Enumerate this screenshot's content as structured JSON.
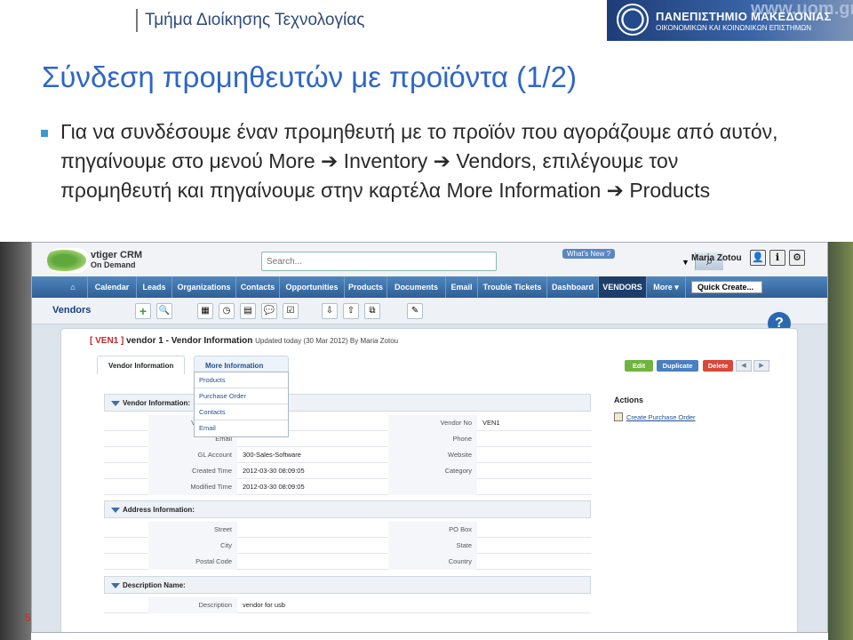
{
  "slide": {
    "department": "Τμήμα Διοίκησης Τεχνολογίας",
    "university_line1": "ΠΑΝΕΠΙΣΤΗΜΙΟ ΜΑΚΕΔΟΝΙΑΣ",
    "university_line2": "ΟΙΚΟΝΟΜΙΚΩΝ ΚΑΙ ΚΟΙΝΩΝΙΚΩΝ ΕΠΙΣΤΗΜΩΝ",
    "university_url": "www.uom.gr",
    "title": "Σύνδεση προμηθευτών με προϊόντα (1/2)",
    "bullet": "Για να συνδέσουμε έναν προμηθευτή με το προϊόν που αγοράζουμε από αυτόν, πηγαίνουμε στο μενού More ➔ Inventory ➔ Vendors, επιλέγουμε τον προμηθευτή και πηγαίνουμε στην καρτέλα More Information ➔ Products",
    "page_number": "5"
  },
  "crm": {
    "logo_line1": "vtiger CRM",
    "logo_line2": "On Demand",
    "search_placeholder": "Search...",
    "whats_new": "What's New ?",
    "user_name": "Maria Zotou",
    "nav": [
      "Calendar",
      "Leads",
      "Organizations",
      "Contacts",
      "Opportunities",
      "Products",
      "Documents",
      "Email",
      "Trouble Tickets",
      "Dashboard",
      "VENDORS",
      "More ▾"
    ],
    "quick_create": "Quick Create...",
    "module": "Vendors",
    "record_id": "[ VEN1 ]",
    "record_title": "vendor 1 - Vendor Information",
    "updated": "Updated today (30 Mar 2012) By Maria Zotou",
    "tabs": [
      "Vendor Information",
      "More Information"
    ],
    "dropdown": [
      "Products",
      "Purchase Order",
      "Contacts",
      "Email"
    ],
    "buttons": {
      "edit": "Edit",
      "duplicate": "Duplicate",
      "delete": "Delete"
    },
    "sections": {
      "vendor_info": "Vendor Information:",
      "address_info": "Address Information:",
      "description_info": "Description Name:"
    },
    "vendor_rows": [
      {
        "l1": "Vendor Name",
        "v1": "",
        "l2": "Vendor No",
        "v2": "VEN1"
      },
      {
        "l1": "Email",
        "v1": "",
        "l2": "Phone",
        "v2": ""
      },
      {
        "l1": "GL Account",
        "v1": "300-Sales-Software",
        "l2": "Website",
        "v2": ""
      },
      {
        "l1": "Created Time",
        "v1": "2012-03-30 08:09:05",
        "l2": "Category",
        "v2": ""
      },
      {
        "l1": "Modified Time",
        "v1": "2012-03-30 08:09:05",
        "l2": "",
        "v2": ""
      }
    ],
    "address_rows": [
      {
        "l1": "Street",
        "v1": "",
        "l2": "PO Box",
        "v2": ""
      },
      {
        "l1": "City",
        "v1": "",
        "l2": "State",
        "v2": ""
      },
      {
        "l1": "Postal Code",
        "v1": "",
        "l2": "Country",
        "v2": ""
      }
    ],
    "description": {
      "label": "Description",
      "value": "vendor for usb"
    },
    "actions_title": "Actions",
    "action_link": "Create Purchase Order"
  },
  "colors": {
    "title": "#2e66c8",
    "navbar": "#3a6ea8",
    "edit": "#6fb43f",
    "duplicate": "#4a7fc1",
    "delete": "#d9473a"
  }
}
